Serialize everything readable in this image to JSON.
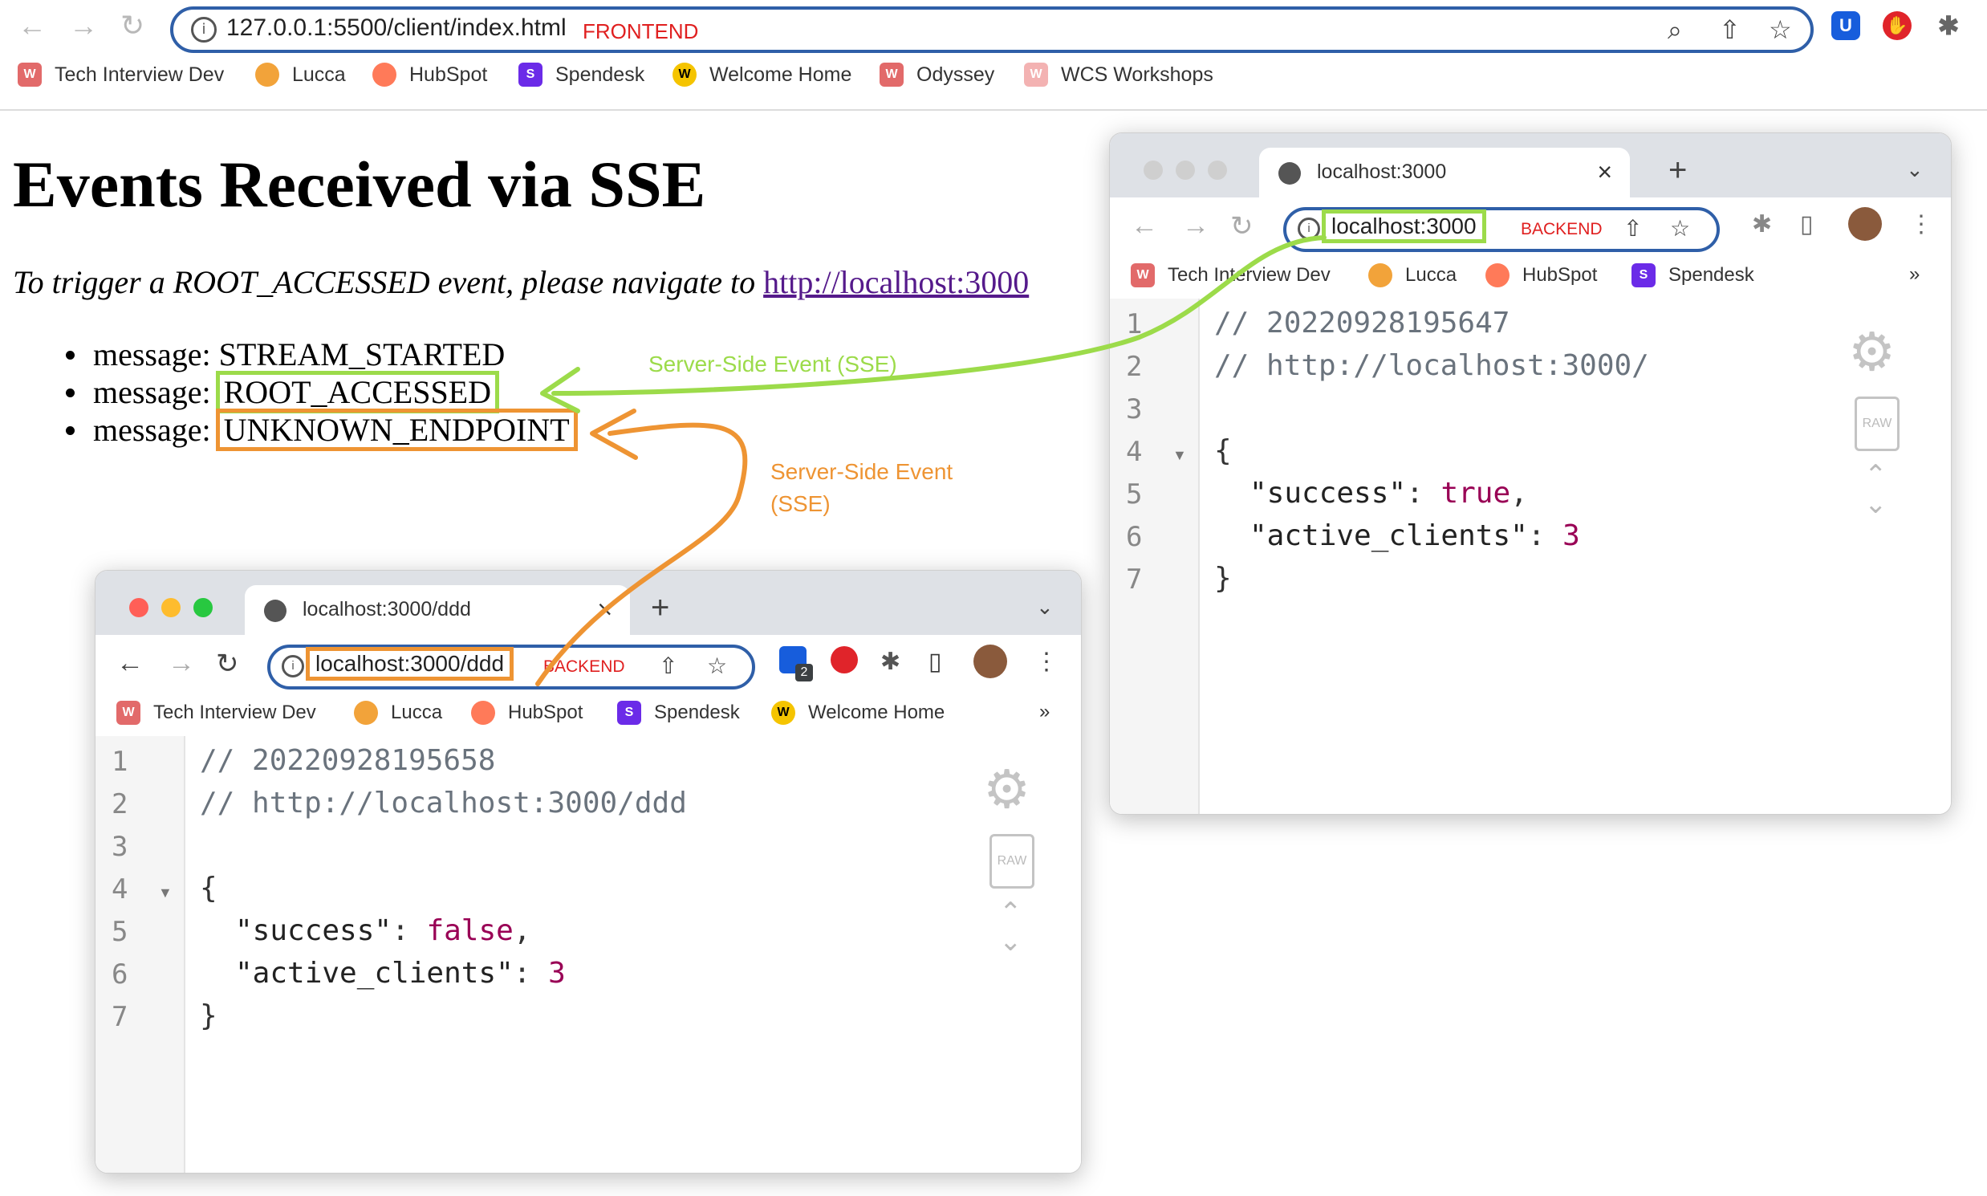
{
  "browser": {
    "url": "127.0.0.1:5500/client/index.html",
    "url_tag": "FRONTEND",
    "bookmarks": [
      "Tech Interview Dev",
      "Lucca",
      "HubSpot",
      "Spendesk",
      "Welcome Home",
      "Odyssey",
      "WCS Workshops"
    ]
  },
  "page": {
    "title": "Events Received via SSE",
    "instruction_prefix": "To trigger a ROOT_ACCESSED event, please navigate to ",
    "instruction_link": "http://localhost:3000",
    "message_prefix": "message:",
    "events": [
      "STREAM_STARTED",
      "ROOT_ACCESSED",
      "UNKNOWN_ENDPOINT"
    ]
  },
  "annotations": {
    "green": "Server-Side Event (SSE)",
    "orange_line1": "Server-Side Event",
    "orange_line2": "(SSE)"
  },
  "colors": {
    "green": "#9cdb4a",
    "orange": "#ee9433",
    "tag_red": "#e02020"
  },
  "win_root": {
    "tab_title": "localhost:3000",
    "url": "localhost:3000",
    "tag": "BACKEND",
    "bookmarks": [
      "Tech Interview Dev",
      "Lucca",
      "HubSpot",
      "Spendesk"
    ],
    "overflow": "»",
    "lines": {
      "l1": "// 20220928195647",
      "l2": "// http://localhost:3000/",
      "l4": "{",
      "l5_key": "\"success\"",
      "l5_val": "true",
      "l6_key": "\"active_clients\"",
      "l6_val": "3",
      "l7": "}"
    }
  },
  "win_ddd": {
    "tab_title": "localhost:3000/ddd",
    "url": "localhost:3000/ddd",
    "tag": "BACKEND",
    "badge": "2",
    "bookmarks": [
      "Tech Interview Dev",
      "Lucca",
      "HubSpot",
      "Spendesk",
      "Welcome Home"
    ],
    "overflow": "»",
    "lines": {
      "l1": "// 20220928195658",
      "l2": "// http://localhost:3000/ddd",
      "l4": "{",
      "l5_key": "\"success\"",
      "l5_val": "false",
      "l6_key": "\"active_clients\"",
      "l6_val": "3",
      "l7": "}"
    }
  }
}
